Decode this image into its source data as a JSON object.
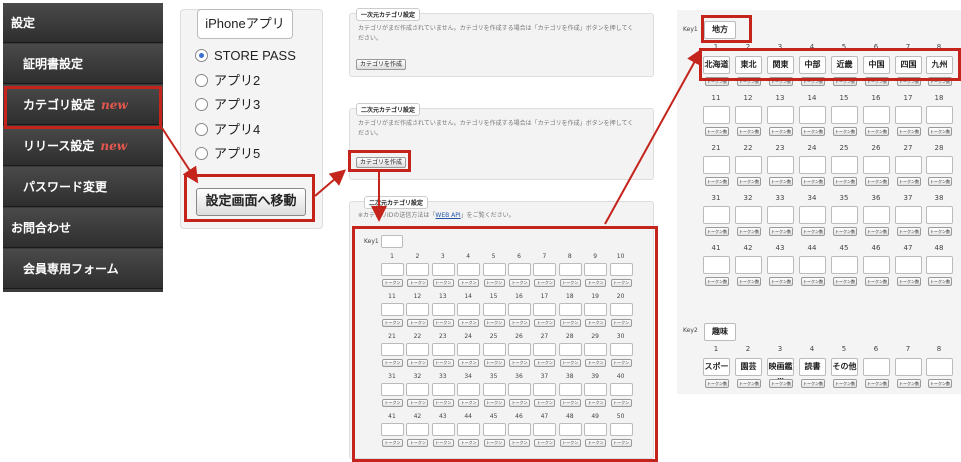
{
  "sidebar": {
    "items": [
      {
        "label": "設定",
        "type": "head"
      },
      {
        "label": "証明書設定",
        "type": "sub"
      },
      {
        "label": "カテゴリ設定",
        "type": "sub",
        "badge": "new"
      },
      {
        "label": "リリース設定",
        "type": "sub",
        "badge": "new"
      },
      {
        "label": "パスワード変更",
        "type": "sub"
      },
      {
        "label": "お問合わせ",
        "type": "head"
      },
      {
        "label": "会員専用フォーム",
        "type": "sub"
      }
    ]
  },
  "app_panel": {
    "legend": "iPhoneアプリ",
    "options": [
      "STORE PASS",
      "アプリ2",
      "アプリ3",
      "アプリ4",
      "アプリ5"
    ],
    "selected": "STORE PASS",
    "button": "設定画面へ移動"
  },
  "category": {
    "one_dim": {
      "title": "一次元カテゴリ設定",
      "text": "カテゴリがまだ作成されていません。カテゴリを作成する場合は「カテゴリを作成」ボタンを押してください。",
      "button": "カテゴリを作成"
    },
    "two_dim": {
      "title": "二次元カテゴリ設定",
      "text": "カテゴリがまだ作成されていません。カテゴリを作成する場合は「カテゴリを作成」ボタンを押してください。",
      "button": "カテゴリを作成"
    },
    "grid_panel": {
      "title": "二次元カテゴリ設定",
      "note_prefix": "※カテゴリIDの送信方法は「",
      "note_link": "WEB API",
      "note_suffix": "」をご覧ください。",
      "key_label": "Key1",
      "token_label": "トークン数"
    }
  },
  "key_panel": {
    "key1": {
      "label": "Key1",
      "value": "地方",
      "row1": [
        "北海道",
        "東北",
        "関東",
        "中部",
        "近畿",
        "中国",
        "四国",
        "九州"
      ]
    },
    "key2": {
      "label": "Key2",
      "value": "趣味",
      "row1": [
        "スポーツ",
        "園芸",
        "映画鑑賞",
        "読書",
        "その他",
        "",
        "",
        ""
      ]
    },
    "token_label": "トークン数"
  },
  "colors": {
    "highlight": "#c4241c",
    "sidebar_bg": "#3a3a3a",
    "new_badge": "#e4574f"
  }
}
